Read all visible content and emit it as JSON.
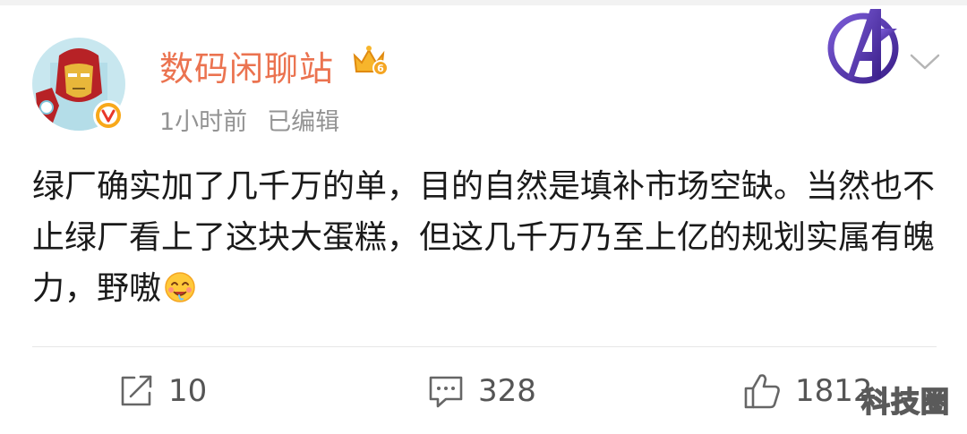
{
  "post": {
    "author": "数码闲聊站",
    "member_level": "6",
    "time": "1小时前",
    "edited": "已编辑",
    "text": "绿厂确实加了几千万的单，目的自然是填补市场空缺。当然也不止绿厂看上了这块大蛋糕，但这几千万乃至上亿的规划实属有魄力，野嗷",
    "text_emoji": "drooling-face-emoji"
  },
  "actions": {
    "repost_count": "10",
    "comment_count": "328",
    "like_count": "1812"
  },
  "icons": {
    "avatar": "iron-man-avatar",
    "verified": "verified-v-badge",
    "crown": "vip-crown-icon",
    "avengers": "avengers-logo",
    "more": "chevron-down-icon",
    "repost": "repost-icon",
    "comment": "comment-icon",
    "like": "thumbs-up-icon"
  },
  "watermark": "科技圈",
  "colors": {
    "username": "#eb7350",
    "meta": "#939393",
    "text": "#1a1a1a",
    "verified_badge": "#f8a81a",
    "action": "#555555"
  }
}
